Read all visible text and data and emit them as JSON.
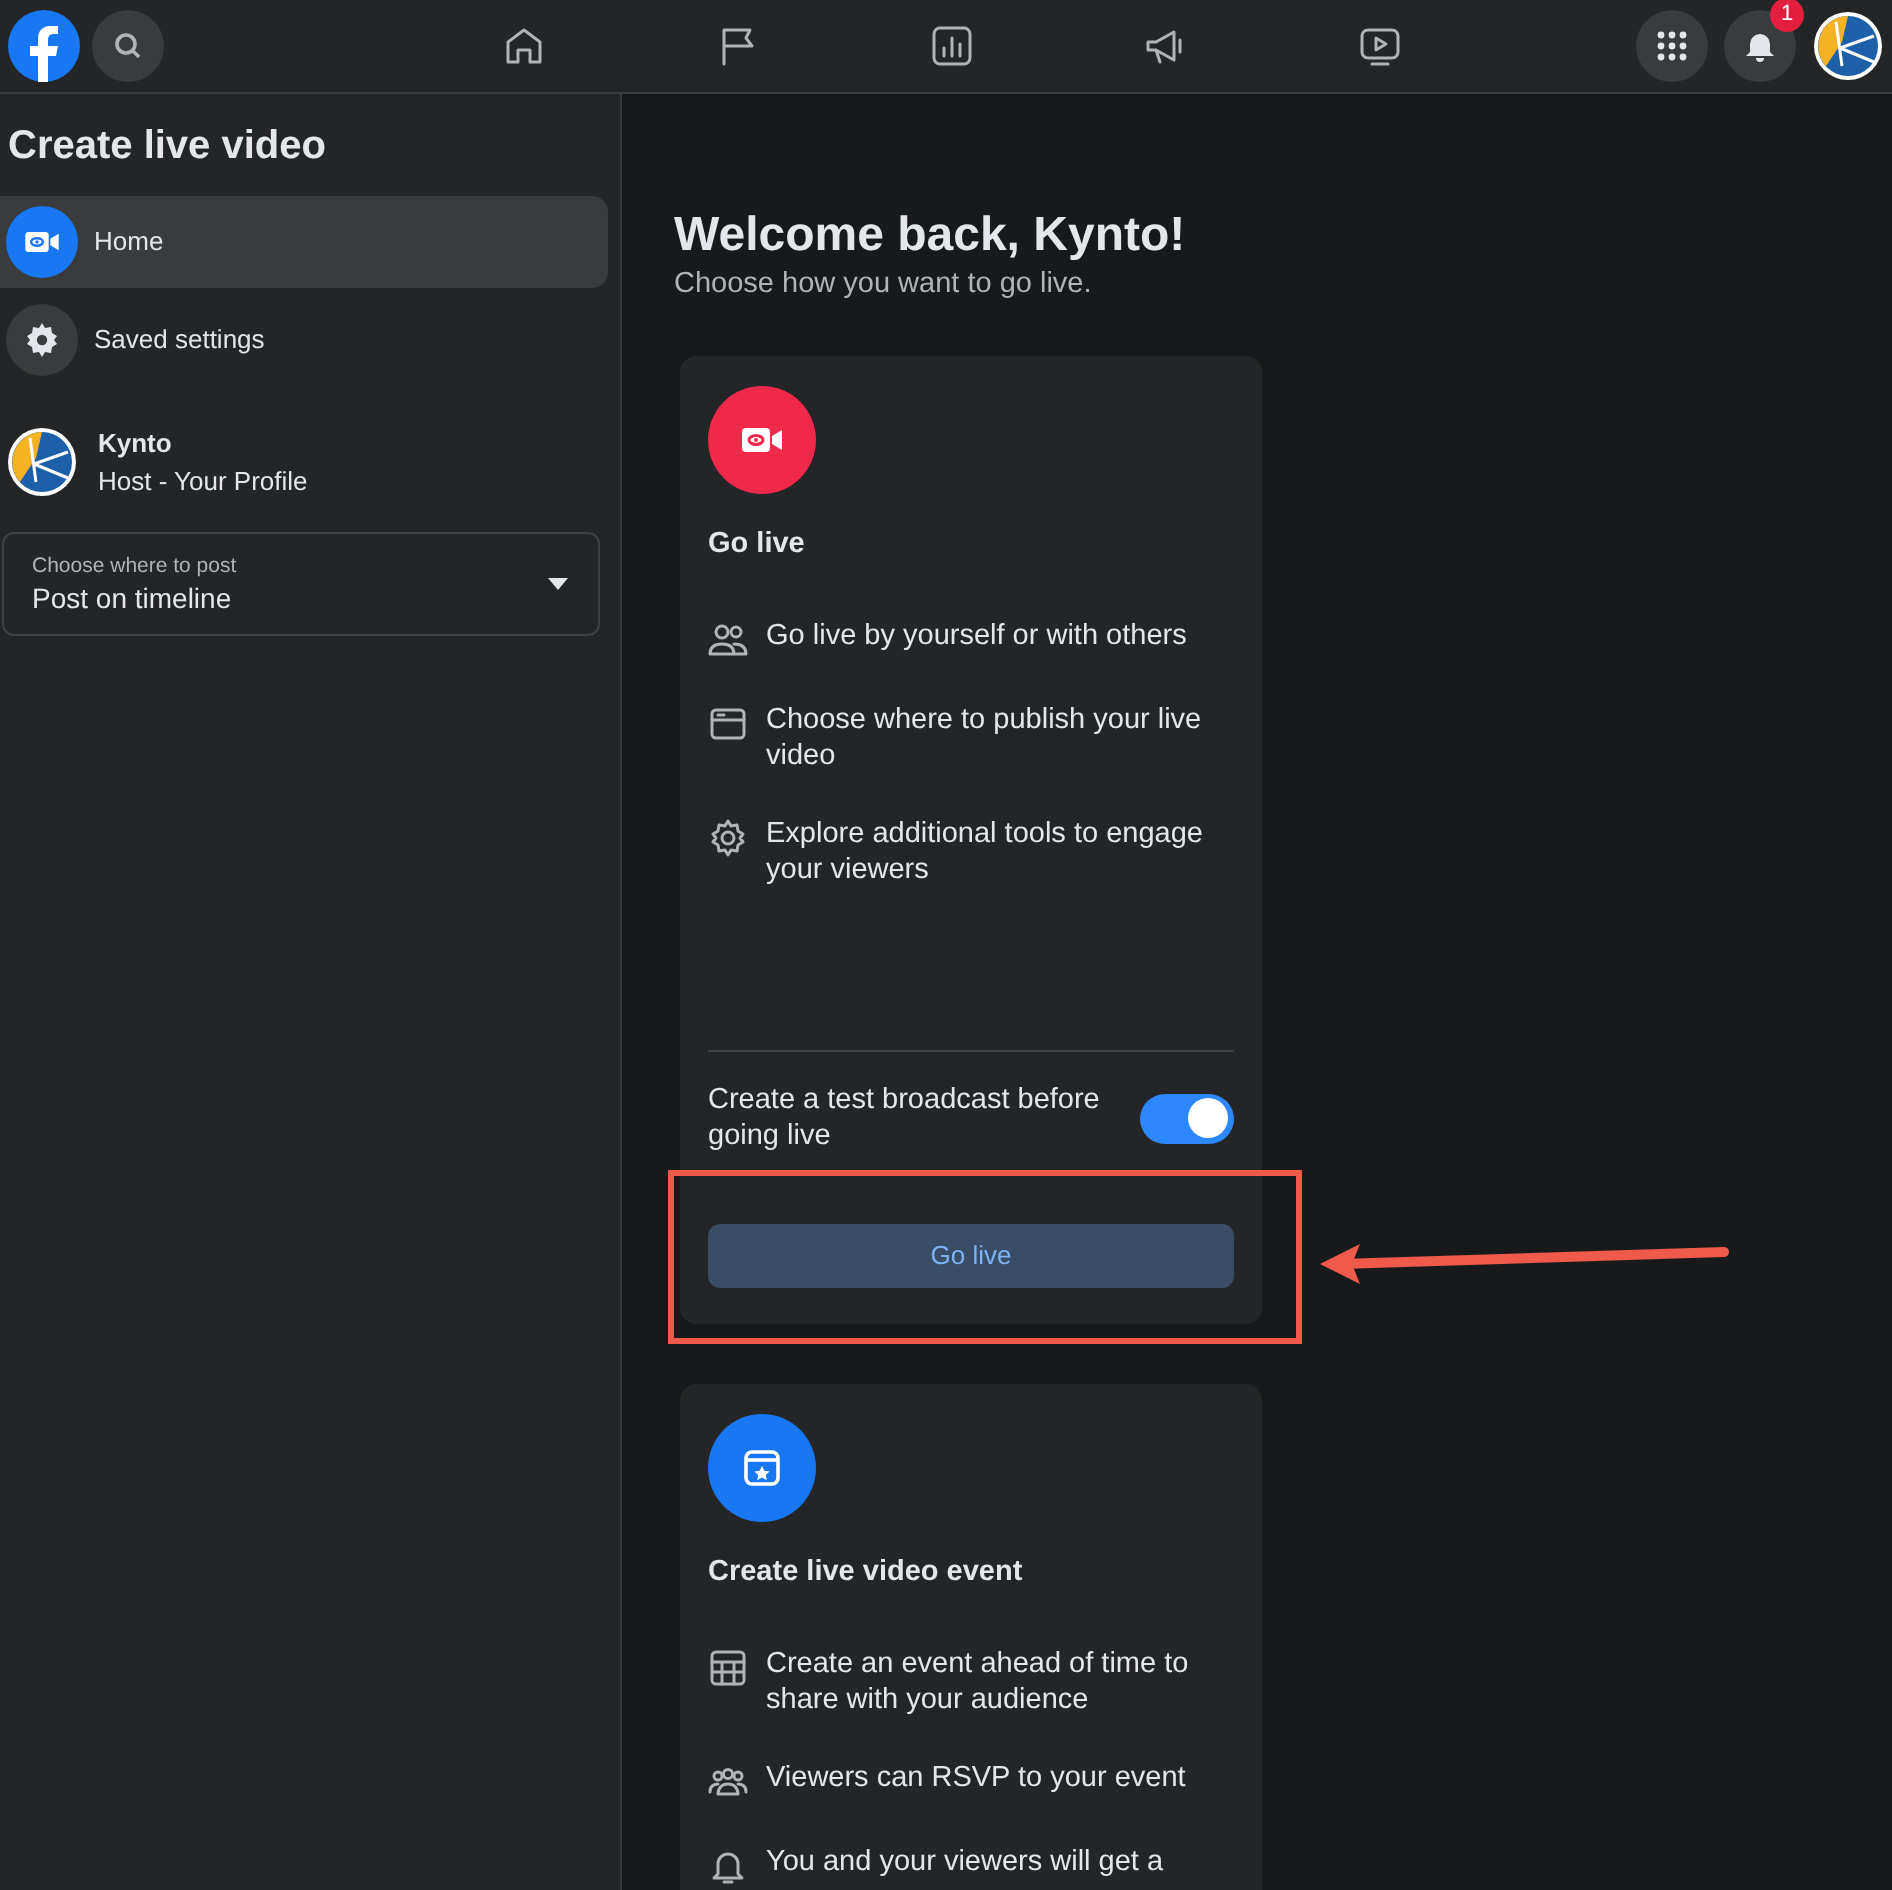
{
  "topbar": {
    "notification_count": "1"
  },
  "sidebar": {
    "title": "Create live video",
    "items": [
      {
        "label": "Home",
        "selected": true
      },
      {
        "label": "Saved settings",
        "selected": false
      }
    ],
    "profile": {
      "name": "Kynto",
      "role": "Host - Your Profile"
    },
    "post_select": {
      "label": "Choose where to post",
      "value": "Post on timeline"
    }
  },
  "main": {
    "heading": "Welcome back, Kynto!",
    "subheading": "Choose how you want to go live.",
    "cards": [
      {
        "title": "Go live",
        "color": "#f02849",
        "features": [
          "Go live by yourself or with others",
          "Choose where to publish your live video",
          "Explore additional tools to engage your viewers"
        ],
        "toggle": {
          "label": "Create a test broadcast before going live",
          "on": true
        },
        "button": "Go live"
      },
      {
        "title": "Create live video event",
        "color": "#1877f2",
        "features": [
          "Create an event ahead of time to share with your audience",
          "Viewers can RSVP to your event",
          "You and your viewers will get a"
        ]
      }
    ]
  }
}
